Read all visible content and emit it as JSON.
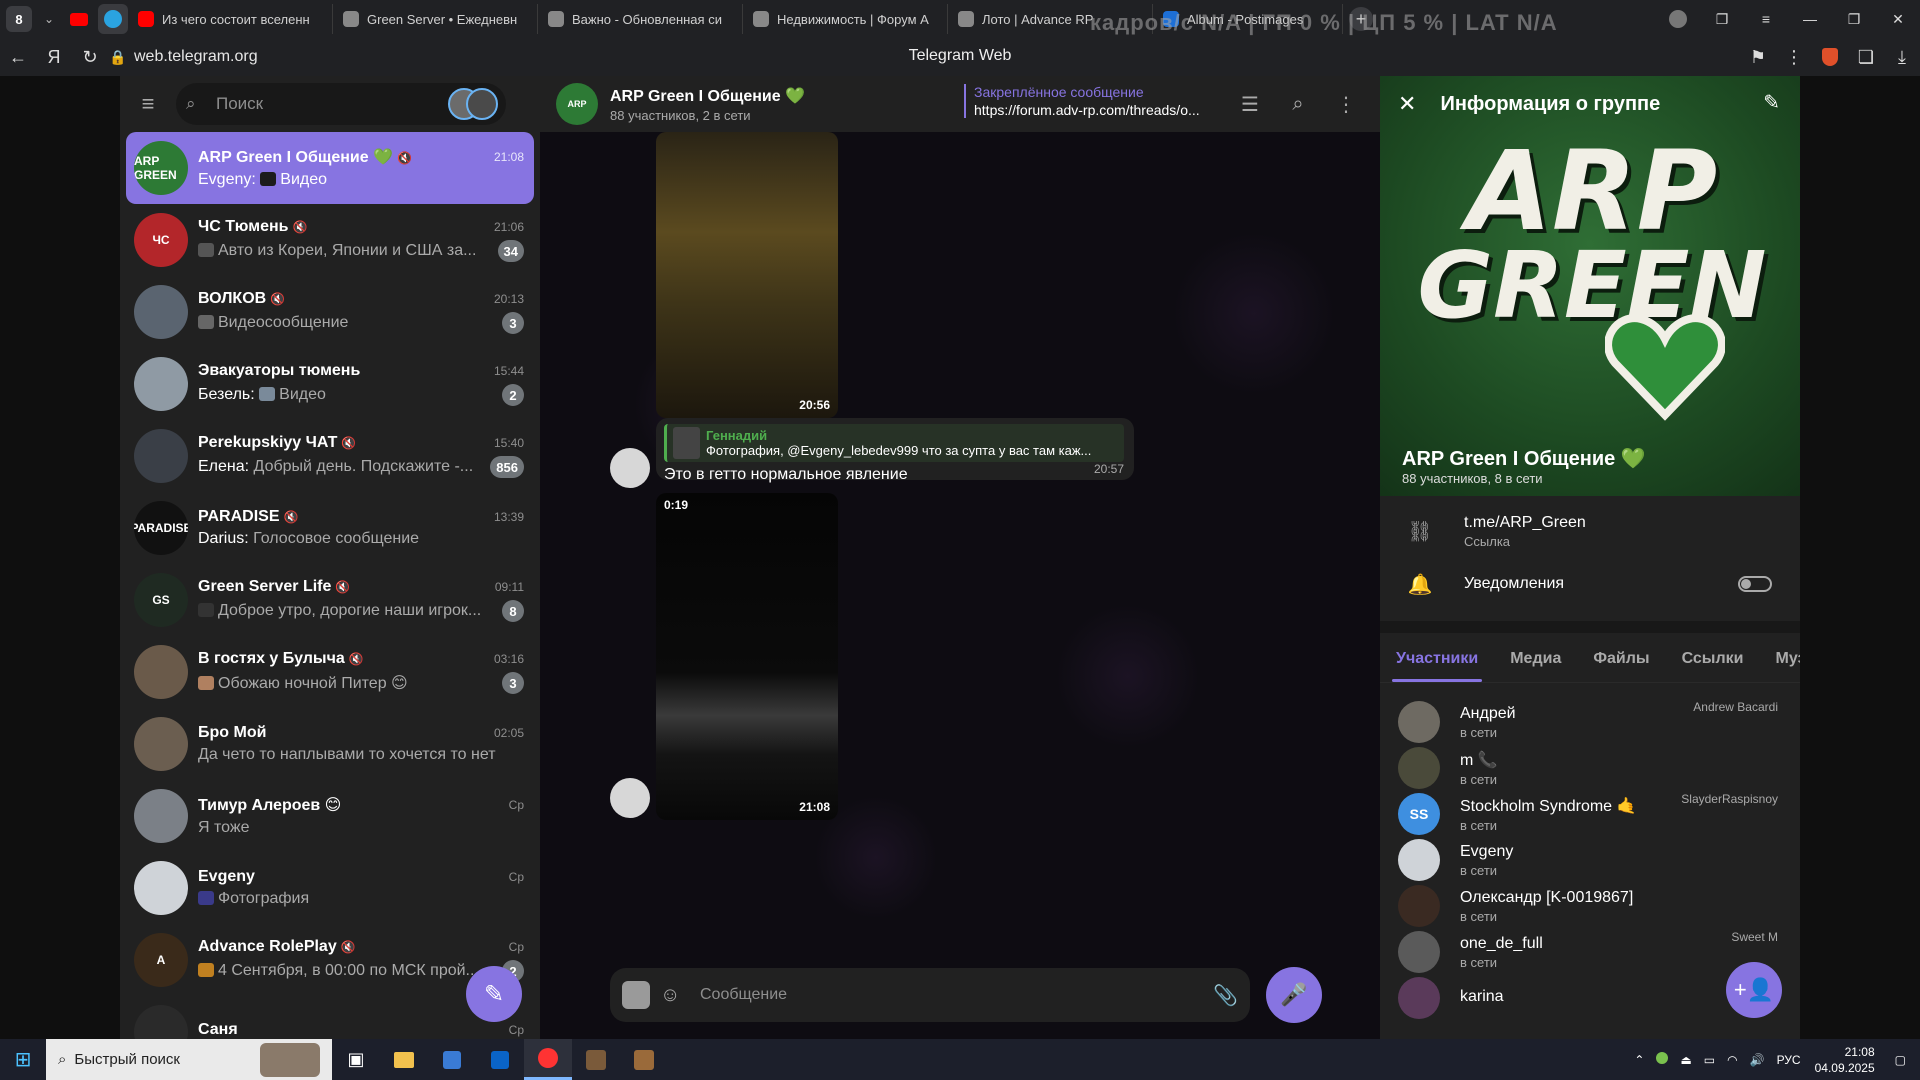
{
  "browser": {
    "tab_count": "8",
    "tabs": [
      {
        "title": "Из чего состоит вселенн",
        "color": "#ff0000"
      },
      {
        "title": "Green Server • Ежедневн",
        "color": "#888888"
      },
      {
        "title": "Важно - Обновленная си",
        "color": "#888888"
      },
      {
        "title": "Недвижимость | Форум А",
        "color": "#888888"
      },
      {
        "title": "Лото | Advance RP",
        "color": "#888888"
      },
      {
        "title": "Album - Postimages",
        "color": "#1d6fd6"
      }
    ],
    "overlay": "кадров/с  N/A  |  ГП  0 %  |  ЦП  5 %  |  LAT  N/A",
    "url": "web.telegram.org",
    "page_title": "Telegram Web"
  },
  "sidebar": {
    "search_placeholder": "Поиск",
    "chats": [
      {
        "name": "ARP Green I Общение 💚",
        "sender": "Evgeny:",
        "last": "Видео",
        "time": "21:08",
        "badge": "",
        "muted": true,
        "active": true,
        "avatar_text": "ARP GREEN",
        "avatar_color": "#2d7a35",
        "thumb_color": "#1c1c1c"
      },
      {
        "name": "ЧС Тюмень",
        "sender": "",
        "last": "Авто из Кореи, Японии и США за...",
        "time": "21:06",
        "badge": "34",
        "muted": true,
        "active": false,
        "avatar_text": "ЧС",
        "avatar_color": "#b3262a",
        "thumb_color": "#555555"
      },
      {
        "name": "ВОЛКОВ",
        "sender": "",
        "last": "Видеосообщение",
        "time": "20:13",
        "badge": "3",
        "muted": true,
        "active": false,
        "avatar_text": "",
        "avatar_color": "#5a6470",
        "thumb_color": "#666666"
      },
      {
        "name": "Эвакуаторы тюмень",
        "sender": "Безель:",
        "last": "Видео",
        "time": "15:44",
        "badge": "2",
        "muted": false,
        "active": false,
        "avatar_text": "",
        "avatar_color": "#8f9aa4",
        "thumb_color": "#7a8a9a"
      },
      {
        "name": "Perekupskiyy ЧАТ",
        "sender": "Елена:",
        "last": "Добрый день. Подскажите -...",
        "time": "15:40",
        "badge": "856",
        "muted": true,
        "active": false,
        "avatar_text": "",
        "avatar_color": "#3a3f47",
        "thumb_color": ""
      },
      {
        "name": "PARADISE",
        "sender": "Darius:",
        "last": "Голосовое сообщение",
        "time": "13:39",
        "badge": "",
        "muted": true,
        "active": false,
        "avatar_text": "PARADISE",
        "avatar_color": "#111111",
        "thumb_color": ""
      },
      {
        "name": "Green Server Life",
        "sender": "",
        "last": "Доброе утро, дорогие наши игрок...",
        "time": "09:11",
        "badge": "8",
        "muted": true,
        "active": false,
        "avatar_text": "GS",
        "avatar_color": "#1f2a22",
        "thumb_color": "#333333"
      },
      {
        "name": "В гостях у Булыча",
        "sender": "",
        "last": "Обожаю ночной Питер 😊",
        "time": "03:16",
        "badge": "3",
        "muted": true,
        "active": false,
        "avatar_text": "",
        "avatar_color": "#6a5a4a",
        "thumb_color": "#b08060"
      },
      {
        "name": "Бро Мой",
        "sender": "",
        "last": "Да чето то наплывами то хочется то нет",
        "time": "02:05",
        "badge": "",
        "muted": false,
        "active": false,
        "avatar_text": "",
        "avatar_color": "#6b5e50",
        "thumb_color": ""
      },
      {
        "name": "Тимур Алероев 😊",
        "sender": "",
        "last": "Я тоже",
        "time": "Ср",
        "badge": "",
        "muted": false,
        "active": false,
        "avatar_text": "",
        "avatar_color": "#7b8087",
        "thumb_color": ""
      },
      {
        "name": "Evgeny",
        "sender": "",
        "last": "Фотография",
        "time": "Ср",
        "badge": "",
        "muted": false,
        "active": false,
        "avatar_text": "",
        "avatar_color": "#cfd3d8",
        "thumb_color": "#3a3a8a"
      },
      {
        "name": "Advance RolePlay",
        "sender": "",
        "last": "4 Сентября, в 00:00 по МСК прой...",
        "time": "Ср",
        "badge": "2",
        "muted": true,
        "active": false,
        "avatar_text": "A",
        "avatar_color": "#3a2a1a",
        "thumb_color": "#c08020"
      },
      {
        "name": "Саня",
        "sender": "",
        "last": "",
        "time": "Ср",
        "badge": "",
        "muted": false,
        "active": false,
        "avatar_text": "",
        "avatar_color": "#2a2a2a",
        "thumb_color": ""
      }
    ]
  },
  "chat": {
    "title": "ARP Green I Общение 💚",
    "subtitle": "88 участников, 2 в сети",
    "pinned_title": "Закреплённое сообщение",
    "pinned_text": "https://forum.adv-rp.com/threads/o...",
    "video1_duration": "20:56",
    "reply_name": "Геннадий",
    "reply_text": "Фотография, @Evgeny_lebedev999 что за супта у вас там каж...",
    "message_text": "Это в гетто нормальное явление",
    "message_time": "20:57",
    "video2_top": "0:19",
    "video2_duration": "21:08",
    "composer_placeholder": "Сообщение"
  },
  "group_info": {
    "panel_title": "Информация о группе",
    "logo_line1": "ARP",
    "logo_line2": "GREEN",
    "name": "ARP Green I Общение 💚",
    "subtitle": "88 участников, 8 в сети",
    "link": "t.me/ARP_Green",
    "link_label": "Ссылка",
    "notifications_label": "Уведомления",
    "notifications_on": false,
    "tabs": [
      "Участники",
      "Медиа",
      "Файлы",
      "Ссылки",
      "Музыка"
    ],
    "members": [
      {
        "name": "Андрей",
        "status": "в сети",
        "role": "Andrew Bacardi",
        "avatar_text": "",
        "avatar_color": "#6e6a62"
      },
      {
        "name": "m 📞",
        "status": "в сети",
        "role": "",
        "avatar_text": "",
        "avatar_color": "#4a4a3a"
      },
      {
        "name": "Stockholm Syndrome 🤙",
        "status": "в сети",
        "role": "SlayderRaspisnoy",
        "avatar_text": "SS",
        "avatar_color": "#3e8fe0"
      },
      {
        "name": "Evgeny",
        "status": "в сети",
        "role": "",
        "avatar_text": "",
        "avatar_color": "#cfd3d8"
      },
      {
        "name": "Олександр [K-0019867]",
        "status": "в сети",
        "role": "",
        "avatar_text": "",
        "avatar_color": "#3a2a22"
      },
      {
        "name": "one_de_full",
        "status": "в сети",
        "role": "Sweet M",
        "avatar_text": "",
        "avatar_color": "#5a5a5a"
      },
      {
        "name": "karina",
        "status": "",
        "role": "",
        "avatar_text": "",
        "avatar_color": "#5a3a5a"
      }
    ]
  },
  "taskbar": {
    "search_placeholder": "Быстрый поиск",
    "lang": "РУС",
    "time": "21:08",
    "date": "04.09.2025"
  },
  "colors": {
    "accent": "#8774e1",
    "sidebar_bg": "#212121",
    "green": "#4fae4e"
  }
}
